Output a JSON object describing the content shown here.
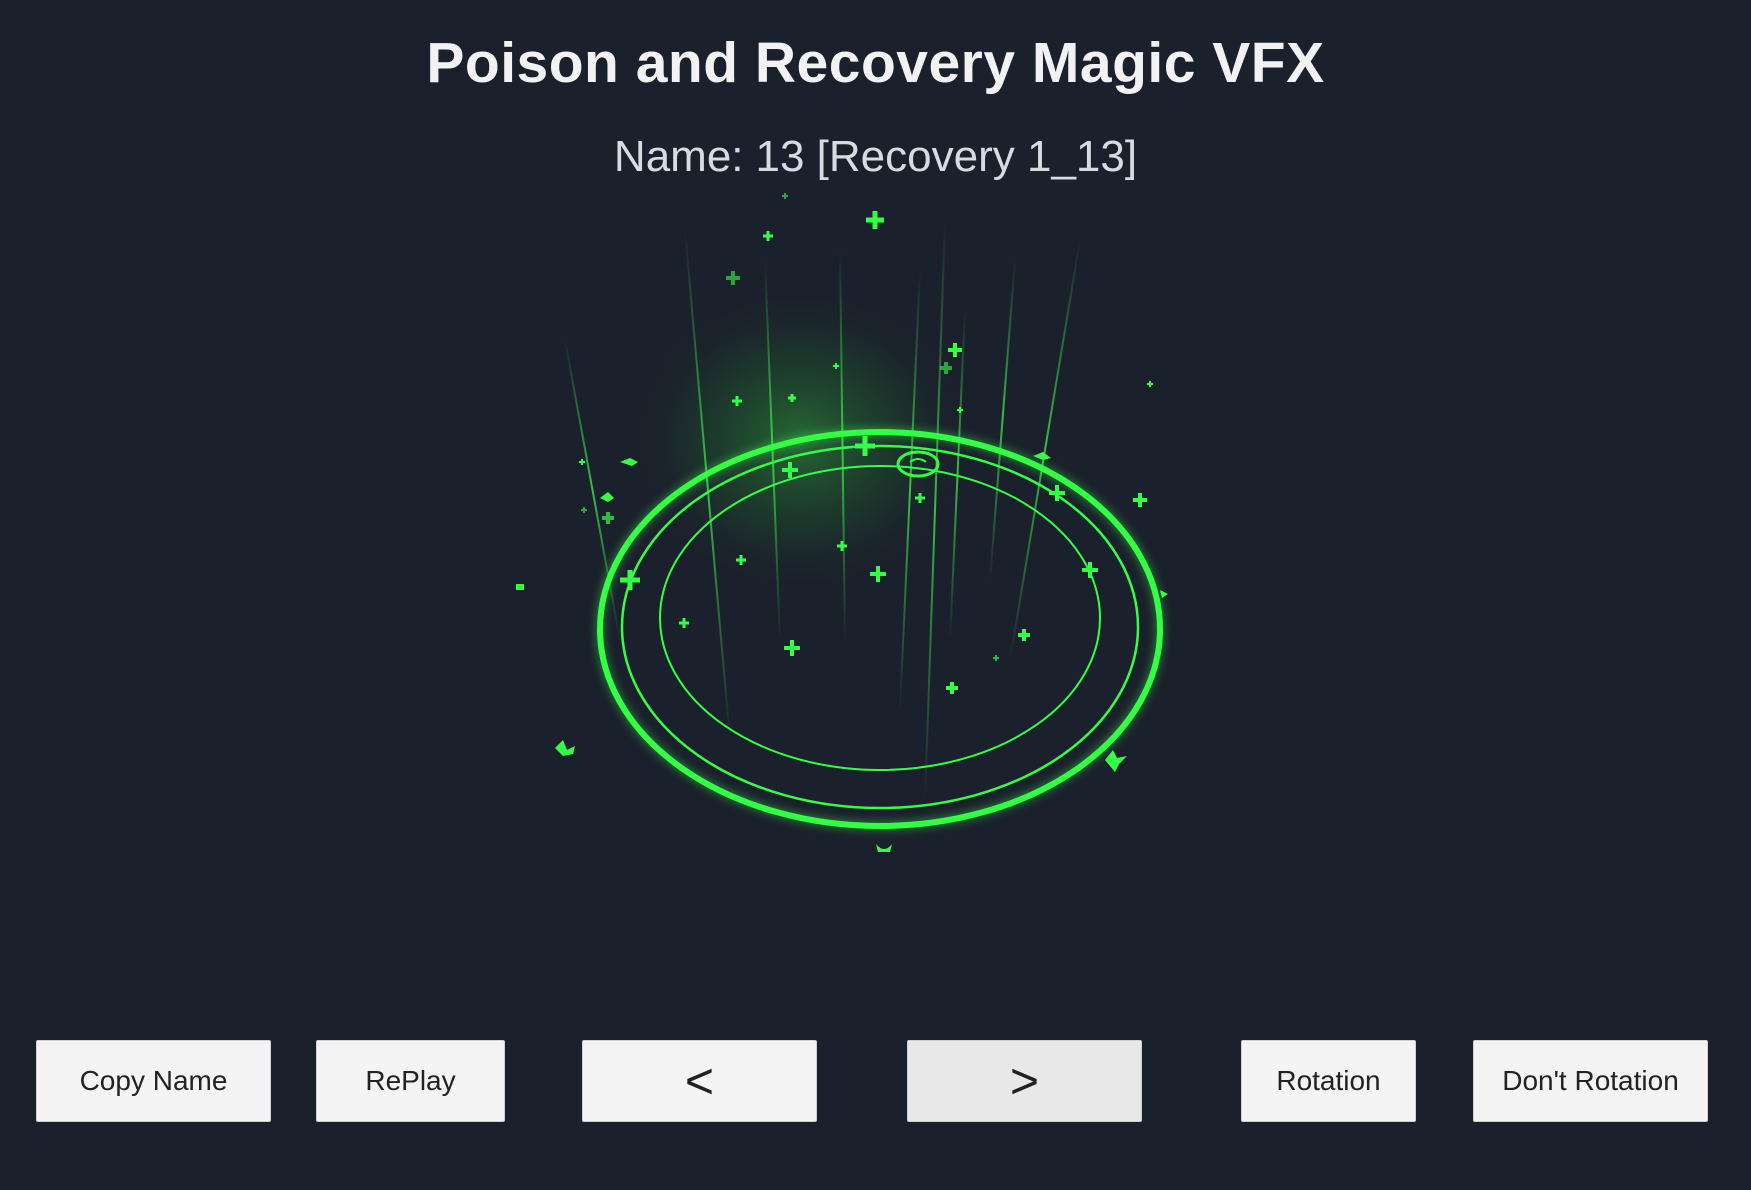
{
  "header": {
    "title": "Poison and Recovery Magic VFX",
    "name_label": "Name:",
    "name_value": "13 [Recovery 1_13]"
  },
  "controls": {
    "copy_name": "Copy Name",
    "replay": "RePlay",
    "prev": "<",
    "next": ">",
    "rotation": "Rotation",
    "dont_rotation": "Don't Rotation"
  },
  "icons": {
    "effect": "recovery-magic-circle-icon"
  },
  "colors": {
    "background": "#1b212c",
    "effect_green": "#33ff44",
    "button_bg": "#f4f4f4"
  }
}
